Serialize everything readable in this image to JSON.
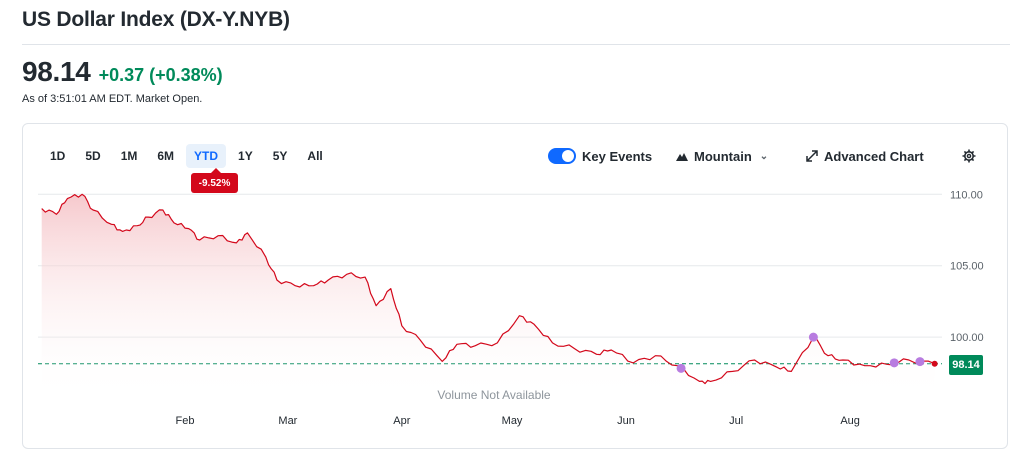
{
  "header": {
    "title": "US Dollar Index (DX-Y.NYB)",
    "price": "98.14",
    "change": "+0.37 (+0.38%)",
    "as_of": "As of 3:51:01 AM EDT. Market Open."
  },
  "ranges": [
    {
      "label": "1D",
      "active": false
    },
    {
      "label": "5D",
      "active": false
    },
    {
      "label": "1M",
      "active": false
    },
    {
      "label": "6M",
      "active": false
    },
    {
      "label": "YTD",
      "active": true
    },
    {
      "label": "1Y",
      "active": false
    },
    {
      "label": "5Y",
      "active": false
    },
    {
      "label": "All",
      "active": false
    }
  ],
  "ytd_change": "-9.52%",
  "toolbar": {
    "key_events_label": "Key Events",
    "key_events_on": true,
    "chart_type_label": "Mountain",
    "advanced_chart_label": "Advanced Chart",
    "settings_icon": "gear-icon",
    "expand_icon": "expand-arrows-icon",
    "mountain_icon": "mountain-icon"
  },
  "colors": {
    "line": "#d3081b",
    "fill": "#f7c9cc",
    "up": "#008a5a",
    "active": "#0f69ff",
    "event_dot": "#b87ce0"
  },
  "chart_data": {
    "type": "area",
    "title": "",
    "xlabel": "",
    "ylabel": "",
    "x_ticks": [
      "Feb",
      "Mar",
      "Apr",
      "May",
      "Jun",
      "Jul",
      "Aug"
    ],
    "y_ticks": [
      "110.00",
      "105.00",
      "100.00"
    ],
    "ylim": [
      95.6,
      111.0
    ],
    "previous_close": 98.14,
    "last_price_label": "98.14",
    "volume_label": "Volume Not Available",
    "grid": true,
    "x": [
      "2025-01-02",
      "2025-01-06",
      "2025-01-09",
      "2025-01-13",
      "2025-01-16",
      "2025-01-21",
      "2025-01-24",
      "2025-01-28",
      "2025-01-31",
      "2025-02-04",
      "2025-02-07",
      "2025-02-11",
      "2025-02-14",
      "2025-02-19",
      "2025-02-24",
      "2025-02-27",
      "2025-03-04",
      "2025-03-07",
      "2025-03-12",
      "2025-03-17",
      "2025-03-21",
      "2025-03-26",
      "2025-03-31",
      "2025-04-03",
      "2025-04-07",
      "2025-04-10",
      "2025-04-15",
      "2025-04-21",
      "2025-04-25",
      "2025-04-30",
      "2025-05-06",
      "2025-05-12",
      "2025-05-16",
      "2025-05-21",
      "2025-05-27",
      "2025-06-02",
      "2025-06-06",
      "2025-06-12",
      "2025-06-18",
      "2025-06-24",
      "2025-06-30",
      "2025-07-03",
      "2025-07-09",
      "2025-07-15",
      "2025-07-21",
      "2025-07-25",
      "2025-07-31",
      "2025-08-04",
      "2025-08-08",
      "2025-08-14",
      "2025-08-20",
      "2025-08-26",
      "2025-09-02"
    ],
    "values": [
      109.0,
      108.6,
      109.7,
      110.0,
      108.9,
      107.9,
      107.4,
      107.8,
      108.4,
      108.9,
      108.0,
      107.6,
      106.8,
      107.1,
      106.6,
      107.3,
      105.6,
      104.0,
      103.6,
      103.6,
      104.0,
      104.4,
      104.2,
      102.2,
      103.4,
      100.8,
      99.8,
      98.3,
      99.5,
      99.4,
      99.6,
      101.5,
      100.9,
      99.6,
      99.2,
      98.8,
      99.1,
      98.2,
      98.7,
      98.0,
      96.9,
      96.9,
      97.6,
      98.4,
      97.9,
      97.6,
      100.0,
      98.7,
      98.4,
      98.0,
      98.1,
      98.4,
      98.14
    ],
    "key_events": [
      "2025-06-25",
      "2025-07-31",
      "2025-08-22",
      "2025-08-29"
    ]
  }
}
